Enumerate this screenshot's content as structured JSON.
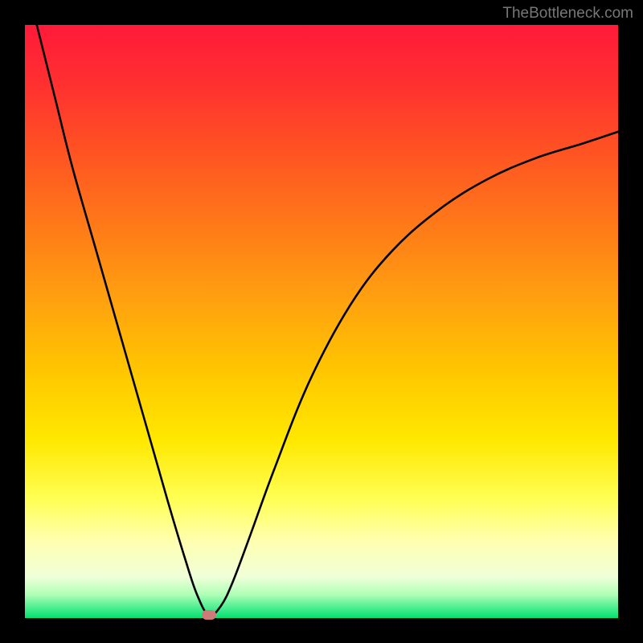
{
  "watermark": "TheBottleneck.com",
  "colors": {
    "marker": "#cf7a7a",
    "curve": "#000000"
  },
  "chart_data": {
    "type": "line",
    "title": "",
    "xlabel": "",
    "ylabel": "",
    "xlim": [
      0,
      100
    ],
    "ylim": [
      0,
      100
    ],
    "grid": false,
    "legend": false,
    "annotations": [
      "TheBottleneck.com"
    ],
    "series": [
      {
        "name": "bottleneck-curve",
        "x": [
          2,
          5,
          8,
          12,
          16,
          20,
          24,
          27,
          29,
          31,
          33,
          35,
          38,
          42,
          48,
          55,
          62,
          70,
          78,
          86,
          94,
          100
        ],
        "y": [
          100,
          88,
          76,
          62,
          48,
          34,
          20,
          10,
          4,
          0.5,
          2,
          6,
          14,
          25,
          40,
          53,
          62,
          69,
          74,
          77.5,
          80,
          82
        ]
      }
    ],
    "marker": {
      "x": 31,
      "y": 0.5
    }
  }
}
